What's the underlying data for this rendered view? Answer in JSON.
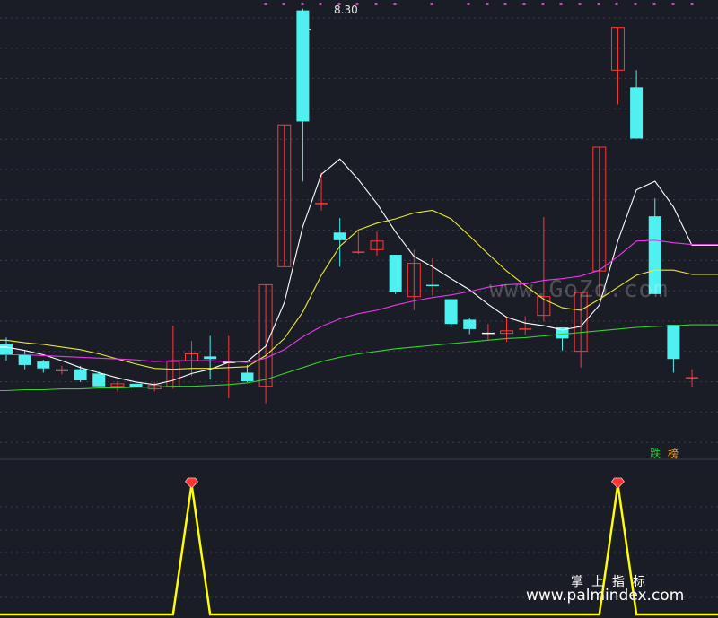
{
  "labels": {
    "max_price": "8.30",
    "tag_left": "跌",
    "tag_right": "榜",
    "watermark_upper": "www.GoZo.com",
    "watermark_cn": "掌上指标",
    "watermark_url": "www.palmindex.com"
  },
  "colors": {
    "background": "#1b1d26",
    "up": "#ff3838",
    "down": "#4ff0f0",
    "ma1": "#ffffff",
    "ma2": "#e8e832",
    "ma3": "#e838e8",
    "ma4": "#32d232",
    "signal": "#ffff00",
    "marker": "#ff3333"
  },
  "chart_data": [
    {
      "type": "candlestick",
      "title": "",
      "ylim": [
        3.12,
        8.38
      ],
      "max_label": 8.3,
      "candles": [
        {
          "o": 4.4,
          "c": 4.27,
          "h": 4.47,
          "l": 4.2
        },
        {
          "o": 4.27,
          "c": 4.15,
          "h": 4.32,
          "l": 4.1
        },
        {
          "o": 4.19,
          "c": 4.11,
          "h": 4.21,
          "l": 4.06
        },
        {
          "o": 4.09,
          "c": 4.09,
          "h": 4.14,
          "l": 4.04
        },
        {
          "o": 4.1,
          "c": 3.97,
          "h": 4.14,
          "l": 3.95
        },
        {
          "o": 4.05,
          "c": 3.9,
          "h": 4.07,
          "l": 3.9
        },
        {
          "o": 3.9,
          "c": 3.93,
          "h": 3.96,
          "l": 3.84
        },
        {
          "o": 3.93,
          "c": 3.89,
          "h": 3.97,
          "l": 3.87
        },
        {
          "o": 3.87,
          "c": 3.91,
          "h": 3.95,
          "l": 3.84
        },
        {
          "o": 3.9,
          "c": 4.19,
          "h": 4.61,
          "l": 3.87
        },
        {
          "o": 4.2,
          "c": 4.28,
          "h": 4.43,
          "l": 4.02
        },
        {
          "o": 4.25,
          "c": 4.22,
          "h": 4.49,
          "l": 3.98
        },
        {
          "o": 4.18,
          "c": 4.18,
          "h": 4.49,
          "l": 3.76
        },
        {
          "o": 4.06,
          "c": 3.96,
          "h": 4.15,
          "l": 3.95
        },
        {
          "o": 3.9,
          "c": 5.09,
          "h": 5.09,
          "l": 3.7
        },
        {
          "o": 5.3,
          "c": 6.96,
          "h": 6.96,
          "l": 5.3
        },
        {
          "o": 8.3,
          "c": 7.0,
          "h": 8.32,
          "l": 6.3
        },
        {
          "o": 6.04,
          "c": 6.04,
          "h": 6.4,
          "l": 5.96
        },
        {
          "o": 5.7,
          "c": 5.61,
          "h": 5.87,
          "l": 5.3
        },
        {
          "o": 5.47,
          "c": 5.47,
          "h": 5.71,
          "l": 5.45
        },
        {
          "o": 5.5,
          "c": 5.6,
          "h": 5.71,
          "l": 5.43
        },
        {
          "o": 5.44,
          "c": 5.0,
          "h": 5.44,
          "l": 4.98
        },
        {
          "o": 4.95,
          "c": 5.34,
          "h": 5.5,
          "l": 4.79
        },
        {
          "o": 5.08,
          "c": 5.08,
          "h": 5.4,
          "l": 4.96
        },
        {
          "o": 4.92,
          "c": 4.63,
          "h": 4.92,
          "l": 4.59
        },
        {
          "o": 4.68,
          "c": 4.57,
          "h": 4.7,
          "l": 4.51
        },
        {
          "o": 4.52,
          "c": 4.52,
          "h": 4.63,
          "l": 4.44
        },
        {
          "o": 4.52,
          "c": 4.55,
          "h": 4.7,
          "l": 4.42
        },
        {
          "o": 4.57,
          "c": 4.57,
          "h": 4.72,
          "l": 4.5
        },
        {
          "o": 4.73,
          "c": 4.95,
          "h": 5.88,
          "l": 4.66
        },
        {
          "o": 4.59,
          "c": 4.46,
          "h": 4.59,
          "l": 4.32
        },
        {
          "o": 4.31,
          "c": 5.0,
          "h": 5.0,
          "l": 4.12
        },
        {
          "o": 5.25,
          "c": 6.7,
          "h": 6.7,
          "l": 4.96
        },
        {
          "o": 7.6,
          "c": 8.1,
          "h": 8.1,
          "l": 7.2
        },
        {
          "o": 7.4,
          "c": 6.8,
          "h": 7.6,
          "l": 6.8
        },
        {
          "o": 5.89,
          "c": 4.98,
          "h": 6.1,
          "l": 4.98
        },
        {
          "o": 4.62,
          "c": 4.22,
          "h": 4.62,
          "l": 4.06
        },
        {
          "o": 4.0,
          "c": 4.0,
          "h": 4.1,
          "l": 3.89
        }
      ],
      "ma_lines": [
        {
          "key": "ma1",
          "values": [
            4.36,
            4.32,
            4.27,
            4.2,
            4.12,
            4.06,
            4.0,
            3.95,
            3.92,
            3.97,
            4.05,
            4.1,
            4.18,
            4.19,
            4.37,
            4.88,
            5.77,
            6.38,
            6.56,
            6.32,
            6.04,
            5.71,
            5.42,
            5.3,
            5.16,
            5.03,
            4.86,
            4.71,
            4.64,
            4.61,
            4.56,
            4.6,
            4.85,
            5.6,
            6.2,
            6.3,
            6.0,
            5.55
          ]
        },
        {
          "key": "ma2",
          "values": [
            4.44,
            4.41,
            4.39,
            4.36,
            4.33,
            4.28,
            4.22,
            4.16,
            4.11,
            4.1,
            4.11,
            4.11,
            4.12,
            4.13,
            4.26,
            4.46,
            4.77,
            5.2,
            5.54,
            5.73,
            5.81,
            5.86,
            5.93,
            5.96,
            5.86,
            5.66,
            5.45,
            5.25,
            5.08,
            4.92,
            4.82,
            4.79,
            4.92,
            5.06,
            5.2,
            5.26,
            5.26,
            5.21
          ]
        },
        {
          "key": "ma3",
          "values": [
            4.27,
            4.27,
            4.26,
            4.25,
            4.24,
            4.23,
            4.22,
            4.21,
            4.19,
            4.2,
            4.2,
            4.2,
            4.19,
            4.18,
            4.23,
            4.33,
            4.48,
            4.6,
            4.69,
            4.75,
            4.79,
            4.85,
            4.9,
            4.94,
            4.97,
            5.01,
            5.06,
            5.09,
            5.1,
            5.14,
            5.16,
            5.19,
            5.26,
            5.42,
            5.6,
            5.61,
            5.58,
            5.56
          ]
        },
        {
          "key": "ma4",
          "values": [
            3.85,
            3.86,
            3.86,
            3.87,
            3.87,
            3.88,
            3.88,
            3.89,
            3.89,
            3.9,
            3.9,
            3.91,
            3.92,
            3.94,
            3.98,
            4.05,
            4.12,
            4.19,
            4.24,
            4.28,
            4.31,
            4.34,
            4.36,
            4.38,
            4.4,
            4.42,
            4.44,
            4.46,
            4.47,
            4.49,
            4.51,
            4.53,
            4.55,
            4.57,
            4.59,
            4.6,
            4.61,
            4.62
          ]
        }
      ]
    },
    {
      "type": "line",
      "title": "",
      "ylim": [
        0,
        1
      ],
      "signal": [
        0,
        0,
        0,
        0,
        0,
        0,
        0,
        0,
        0,
        0,
        1,
        0,
        0,
        0,
        0,
        0,
        0,
        0,
        0,
        0,
        0,
        0,
        0,
        0,
        0,
        0,
        0,
        0,
        0,
        0,
        0,
        0,
        0,
        1,
        0,
        0,
        0,
        0
      ],
      "markers_at": [
        10,
        33
      ]
    }
  ]
}
